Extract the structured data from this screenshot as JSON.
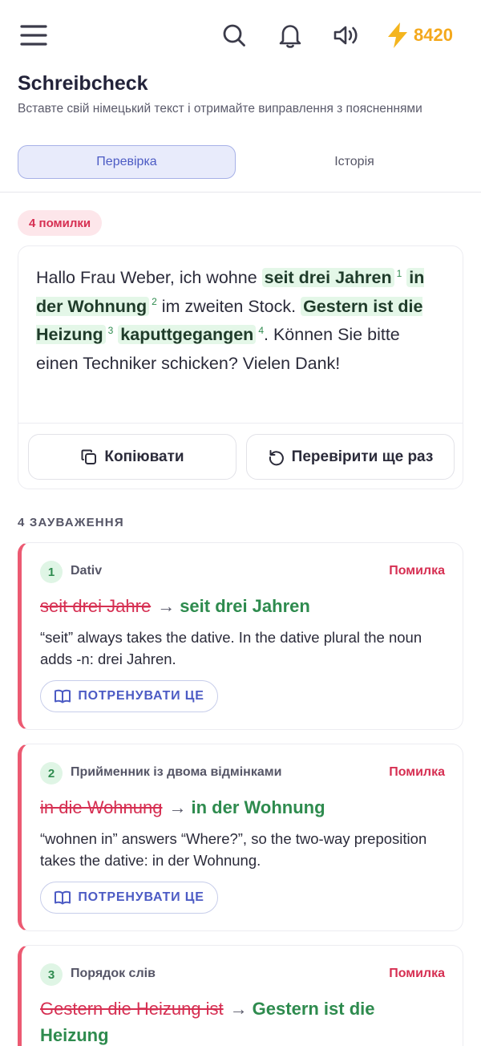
{
  "topbar": {
    "streak_value": "8420",
    "icons": [
      "menu-icon",
      "search-icon",
      "bell-icon",
      "sound-icon",
      "lightning-icon"
    ],
    "accent_color": "#f4a81c"
  },
  "header": {
    "title": "Schreibcheck",
    "subtitle": "Вставте свій німецький текст і отримайте виправлення з поясненнями"
  },
  "tabs": [
    {
      "label": "Перевірка",
      "active": true
    },
    {
      "label": "Історія",
      "active": false
    }
  ],
  "result": {
    "error_badge": "4 помилки",
    "text": {
      "p1": "Hallo Frau Weber, ich wohne ",
      "c1": "seit drei Jahren",
      "n1": "1",
      "p2": " ",
      "c2": "in der Wohnung",
      "n2": "2",
      "p3": " im zweiten Stock. ",
      "c3": "Gestern ist die Heizung",
      "n3": "3",
      "p4": " ",
      "c4": "kaputtgegangen",
      "n4": "4",
      "p5": ". Können Sie bitte einen Techniker schicken? Vielen Dank!"
    },
    "copy_label": "Копіювати",
    "recheck_label": "Перевірити ще раз"
  },
  "issues_section": {
    "label": "4 ЗАУВАЖЕННЯ",
    "items": [
      {
        "num": "1",
        "category": "Dativ",
        "severity": "Помилка",
        "wrong": "seit drei Jahre",
        "correct": "seit drei Jahren",
        "explanation": "“seit” always takes the dative. In the dative plural the noun adds -n: drei Jahren.",
        "train_label": "ПОТРЕНУВАТИ ЦЕ"
      },
      {
        "num": "2",
        "category": "Прийменник із двома відмінками",
        "severity": "Помилка",
        "wrong": "in die Wohnung",
        "correct": "in der Wohnung",
        "explanation": "“wohnen in” answers “Where?”, so the two-way preposition takes the dative: in der Wohnung.",
        "train_label": "ПОТРЕНУВАТИ ЦЕ"
      },
      {
        "num": "3",
        "category": "Порядок слів",
        "severity": "Помилка",
        "wrong": "Gestern die Heizung ist",
        "correct": "Gestern ist die Heizung",
        "explanation": "",
        "train_label": ""
      }
    ]
  },
  "colors": {
    "error": "#d62f52",
    "correct": "#2e8b4e",
    "primary": "#4c5bc4",
    "highlight": "#e4f7e8"
  }
}
